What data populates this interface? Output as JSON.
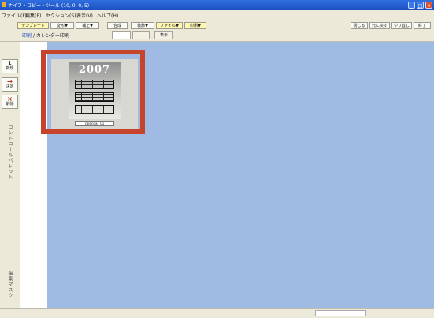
{
  "window": {
    "title": "ナイフ・コピー・ツール (10, 0, 0, 5)",
    "controls": [
      "_",
      "□",
      "×"
    ]
  },
  "menubar": {
    "items": [
      "ファイル(F)",
      "編集(E)",
      "セクション(S)",
      "表示(V)",
      "ヘルプ(H)"
    ]
  },
  "toolbar": {
    "buttons": [
      "テンプレート",
      "変形▼",
      "補正▼",
      "合成",
      "装飾▼",
      "ファイル▼",
      "印刷▼"
    ],
    "right_buttons": [
      "閉じる",
      "元に戻す",
      "やり直し",
      "終了"
    ],
    "mode_label_prefix": "印刷",
    "mode_label_main": "カレンダー印刷",
    "tabs": [
      "",
      "",
      "表示"
    ]
  },
  "sidebar": {
    "buttons": [
      {
        "icon": "↓",
        "label": "新規"
      },
      {
        "icon": "→",
        "label": "決定"
      },
      {
        "icon": "×",
        "label": "削除"
      }
    ],
    "vertical_label_top": "コントロールパレット",
    "vertical_label_bottom": "編集マスク"
  },
  "canvas": {
    "thumbnail": {
      "year": "2007",
      "caption": "calendar_01"
    }
  },
  "colors": {
    "canvas_bg": "#9fbbe4",
    "highlight": "#c5442b",
    "titlebar": "#2f6fe0"
  }
}
